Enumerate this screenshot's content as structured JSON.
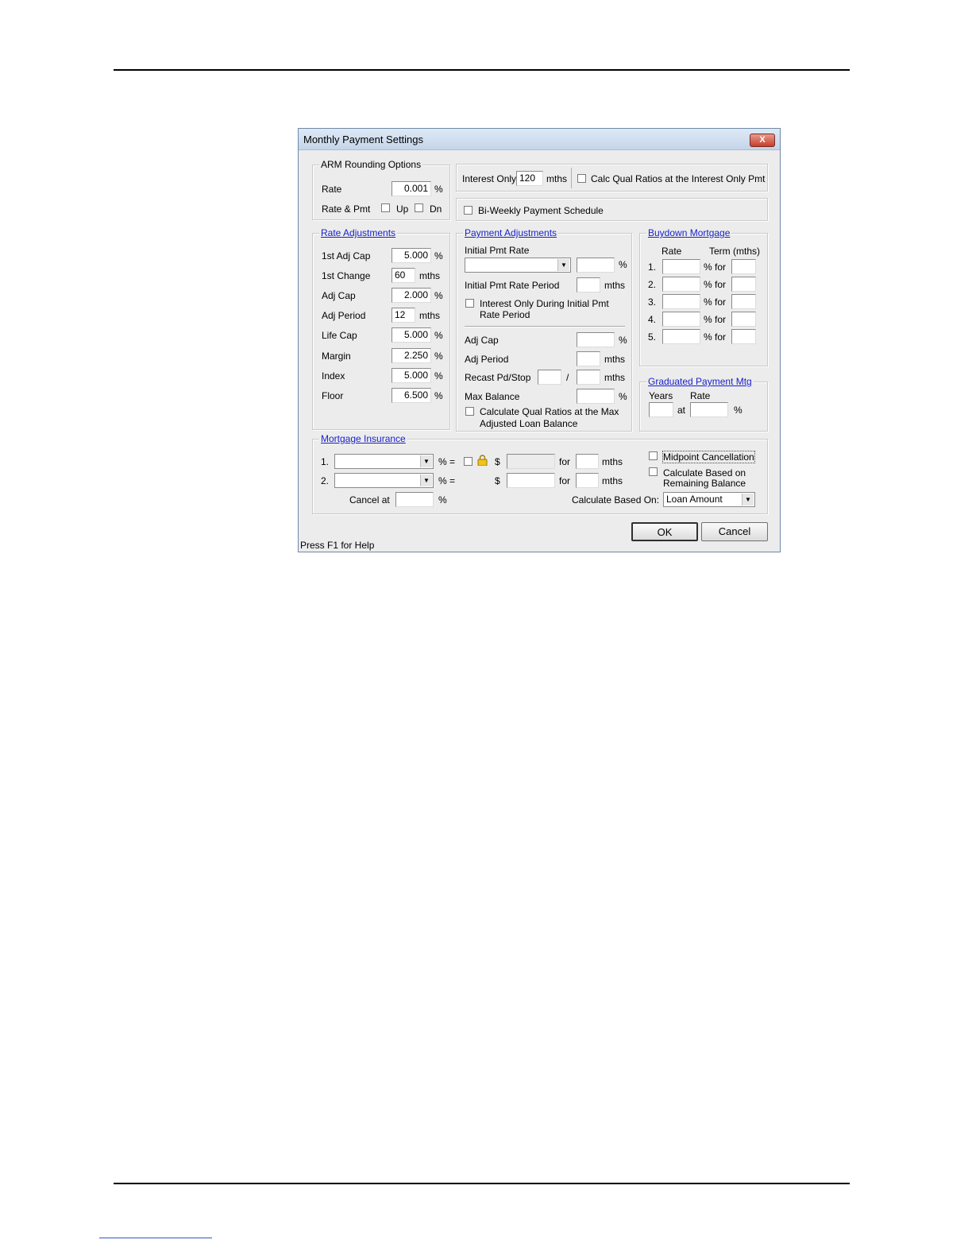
{
  "dialog": {
    "title": "Monthly Payment Settings",
    "close_label": "X",
    "status_bar": "Press F1 for Help",
    "ok_label": "OK",
    "cancel_label": "Cancel"
  },
  "arm_rounding": {
    "title": "ARM Rounding Options",
    "rate_label": "Rate",
    "rate_value": "0.001",
    "pct": "%",
    "rate_pmt_label": "Rate & Pmt",
    "up_label": "Up",
    "dn_label": "Dn"
  },
  "interest_only": {
    "label": "Interest Only",
    "value": "120",
    "unit": "mths",
    "calc_qual_label": "Calc Qual Ratios at the Interest Only Pmt"
  },
  "biweekly": {
    "label": "Bi-Weekly Payment Schedule"
  },
  "rate_adjustments": {
    "title": "Rate Adjustments",
    "rows": [
      {
        "label": "1st Adj Cap",
        "value": "5.000",
        "unit": "%"
      },
      {
        "label": "1st Change",
        "value": "60",
        "unit": "mths"
      },
      {
        "label": "Adj Cap",
        "value": "2.000",
        "unit": "%"
      },
      {
        "label": "Adj Period",
        "value": "12",
        "unit": "mths"
      },
      {
        "label": "Life Cap",
        "value": "5.000",
        "unit": "%"
      },
      {
        "label": "Margin",
        "value": "2.250",
        "unit": "%"
      },
      {
        "label": "Index",
        "value": "5.000",
        "unit": "%"
      },
      {
        "label": "Floor",
        "value": "6.500",
        "unit": "%"
      }
    ]
  },
  "payment_adjustments": {
    "title": "Payment Adjustments",
    "initial_pmt_rate_label": "Initial Pmt Rate",
    "pct": "%",
    "initial_pmt_period_label": "Initial Pmt Rate Period",
    "mths": "mths",
    "interest_only_during_line1": "Interest Only During Initial Pmt",
    "interest_only_during_line2": "Rate Period",
    "adj_cap_label": "Adj Cap",
    "adj_period_label": "Adj Period",
    "recast_label": "Recast Pd/Stop",
    "slash": "/",
    "max_balance_label": "Max Balance",
    "calc_qual_line1": "Calculate Qual Ratios at the Max",
    "calc_qual_line2": "Adjusted Loan Balance"
  },
  "buydown": {
    "title": "Buydown Mortgage",
    "rate_header": "Rate",
    "term_header": "Term (mths)",
    "rows": [
      {
        "num": "1.",
        "pct_for": "% for"
      },
      {
        "num": "2.",
        "pct_for": "% for"
      },
      {
        "num": "3.",
        "pct_for": "% for"
      },
      {
        "num": "4.",
        "pct_for": "% for"
      },
      {
        "num": "5.",
        "pct_for": "% for"
      }
    ]
  },
  "graduated": {
    "title": "Graduated Payment Mtg",
    "years_header": "Years",
    "rate_header": "Rate",
    "at_label": "at",
    "pct": "%"
  },
  "mortgage_insurance": {
    "title": "Mortgage Insurance",
    "row1_num": "1.",
    "row2_num": "2.",
    "pct_eq": "% =",
    "dollar": "$",
    "for_label": "for",
    "mths": "mths",
    "cancel_at_label": "Cancel at",
    "pct": "%",
    "midpoint_label": "Midpoint Cancellation",
    "calc_remaining_line1": "Calculate Based on",
    "calc_remaining_line2": "Remaining Balance",
    "calc_based_on_label": "Calculate Based On:",
    "calc_based_on_value": "Loan Amount"
  }
}
